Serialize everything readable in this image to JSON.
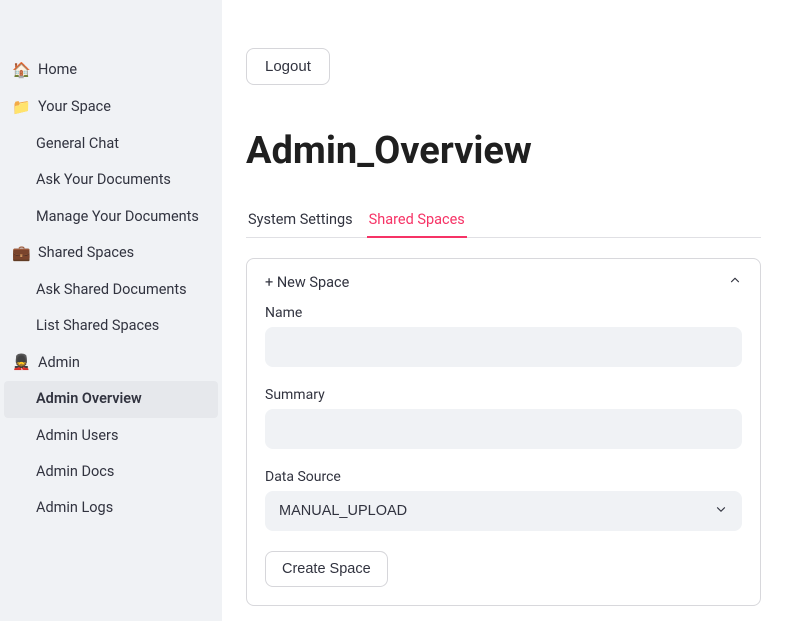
{
  "sidebar": {
    "items": [
      {
        "icon": "🏠",
        "label": "Home",
        "sub": false
      },
      {
        "icon": "📁",
        "label": "Your Space",
        "sub": false
      },
      {
        "icon": "",
        "label": "General Chat",
        "sub": true
      },
      {
        "icon": "",
        "label": "Ask Your Documents",
        "sub": true
      },
      {
        "icon": "",
        "label": "Manage Your Documents",
        "sub": true
      },
      {
        "icon": "💼",
        "label": "Shared Spaces",
        "sub": false
      },
      {
        "icon": "",
        "label": "Ask Shared Documents",
        "sub": true
      },
      {
        "icon": "",
        "label": "List Shared Spaces",
        "sub": true
      },
      {
        "icon": "💂",
        "label": "Admin",
        "sub": false
      },
      {
        "icon": "",
        "label": "Admin Overview",
        "sub": true,
        "active": true
      },
      {
        "icon": "",
        "label": "Admin Users",
        "sub": true
      },
      {
        "icon": "",
        "label": "Admin Docs",
        "sub": true
      },
      {
        "icon": "",
        "label": "Admin Logs",
        "sub": true
      }
    ]
  },
  "header": {
    "logout_label": "Logout"
  },
  "page": {
    "title": "Admin_Overview"
  },
  "tabs": [
    {
      "label": "System Settings",
      "active": false
    },
    {
      "label": "Shared Spaces",
      "active": true
    }
  ],
  "expander": {
    "title": "+ New Space",
    "fields": {
      "name_label": "Name",
      "name_value": "",
      "summary_label": "Summary",
      "summary_value": "",
      "data_source_label": "Data Source",
      "data_source_value": "MANUAL_UPLOAD"
    },
    "submit_label": "Create Space"
  }
}
